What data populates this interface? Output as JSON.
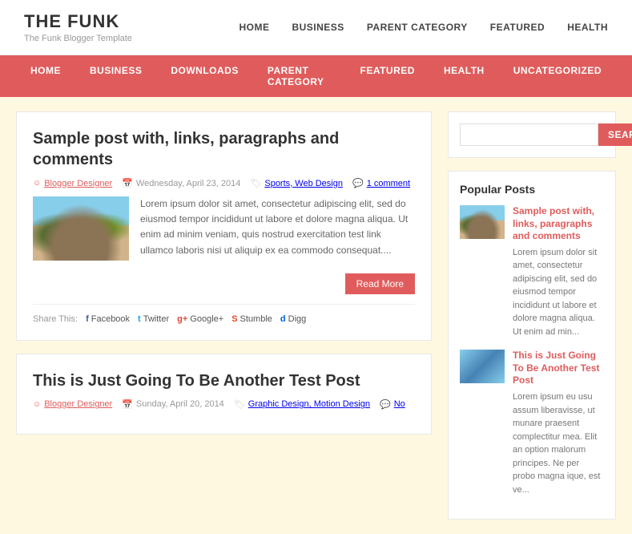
{
  "site": {
    "title": "THE FUNK",
    "tagline": "The Funk Blogger Template"
  },
  "top_nav": {
    "items": [
      {
        "label": "HOME",
        "href": "#"
      },
      {
        "label": "BUSINESS",
        "href": "#"
      },
      {
        "label": "PARENT CATEGORY",
        "href": "#"
      },
      {
        "label": "FEATURED",
        "href": "#"
      },
      {
        "label": "HEALTH",
        "href": "#"
      }
    ]
  },
  "main_nav": {
    "items": [
      {
        "label": "HOME"
      },
      {
        "label": "BUSINESS"
      },
      {
        "label": "DOWNLOADS"
      },
      {
        "label": "PARENT CATEGORY"
      },
      {
        "label": "FEATURED"
      },
      {
        "label": "HEALTH"
      },
      {
        "label": "UNCATEGORIZED"
      }
    ]
  },
  "posts": [
    {
      "title": "Sample post with, links, paragraphs and comments",
      "author": "Blogger Designer",
      "date": "Wednesday, April 23, 2014",
      "categories": "Sports, Web Design",
      "comments": "1 comment",
      "excerpt": "Lorem ipsum dolor sit amet, consectetur adipiscing elit, sed do eiusmod tempor incididunt ut labore et dolore magna aliqua. Ut enim ad minim veniam, quis nostrud exercitation test link ullamco laboris nisi ut aliquip ex ea commodo consequat....",
      "read_more": "Read More"
    },
    {
      "title": "This is Just Going To Be Another Test Post",
      "author": "Blogger Designer",
      "date": "Sunday, April 20, 2014",
      "categories": "Graphic Design, Motion Design",
      "comments": "No"
    }
  ],
  "share": {
    "label": "Share This:",
    "items": [
      {
        "label": "Facebook"
      },
      {
        "label": "Twitter"
      },
      {
        "label": "Google+"
      },
      {
        "label": "Stumble"
      },
      {
        "label": "Digg"
      }
    ]
  },
  "sidebar": {
    "search_placeholder": "",
    "search_button": "SEARCH",
    "popular_posts_title": "Popular Posts",
    "popular_posts": [
      {
        "title": "Sample post with, links, paragraphs and comments",
        "excerpt": "Lorem ipsum dolor sit amet, consectetur adipiscing elit, sed do eiusmod tempor incididunt ut labore et dolore magna aliqua. Ut enim ad min..."
      },
      {
        "title": "This is Just Going To Be Another Test Post",
        "excerpt": "Lorem ipsum eu usu assum liberavisse, ut munare praesent complectitur mea. Elit an option malorum principes. Ne per probo magna ique, est ve..."
      }
    ]
  }
}
